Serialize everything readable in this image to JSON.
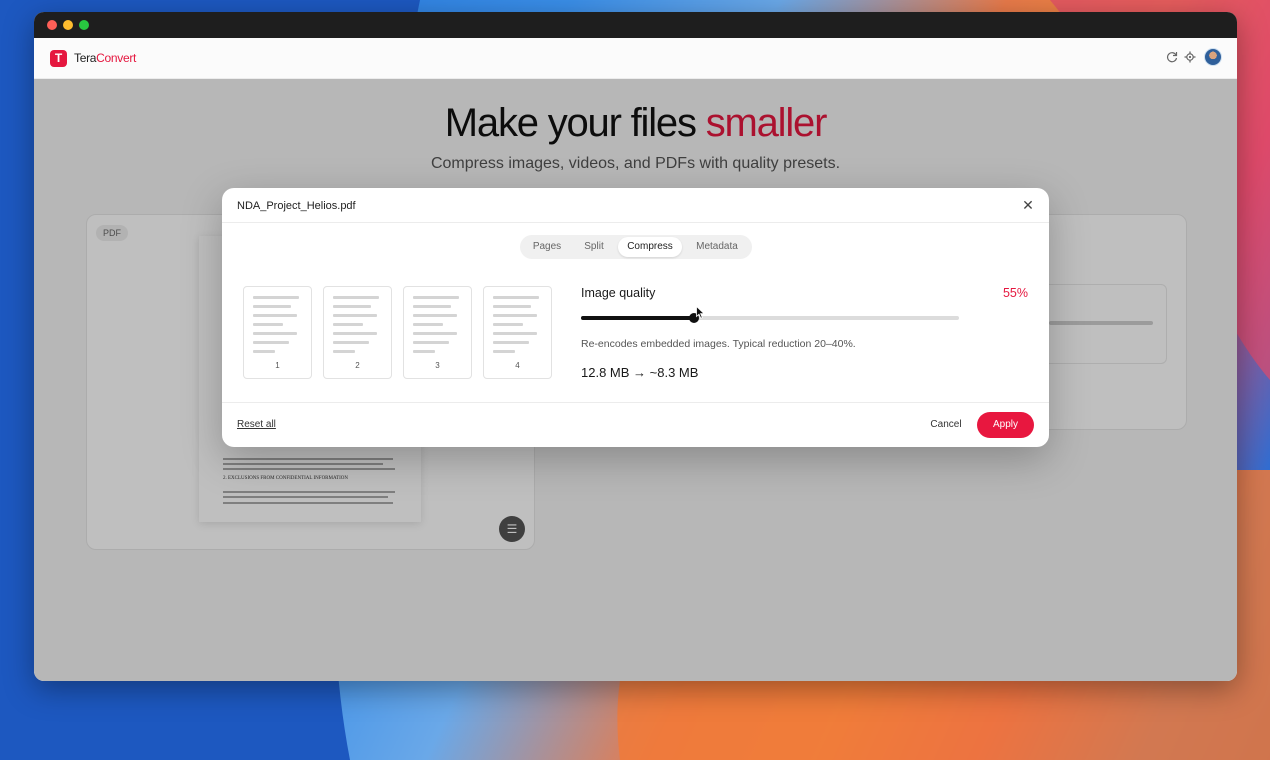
{
  "app": {
    "brand_part1": "Tera",
    "brand_part2": "Convert",
    "logo_letter": "T"
  },
  "header": {
    "icons": [
      "refresh-icon",
      "gear-icon"
    ]
  },
  "hero": {
    "title_main": "Make your files ",
    "title_accent": "smaller",
    "subtitle": "Compress images, videos, and PDFs with quality presets."
  },
  "background_card": {
    "tag": "PDF",
    "doc_heading": "2. EXCLUSIONS FROM CONFIDENTIAL INFORMATION"
  },
  "modal": {
    "filename": "NDA_Project_Helios.pdf",
    "close_symbol": "✕",
    "tabs": [
      {
        "label": "Pages",
        "active": false
      },
      {
        "label": "Split",
        "active": false
      },
      {
        "label": "Compress",
        "active": true
      },
      {
        "label": "Metadata",
        "active": false
      }
    ],
    "thumbnails": [
      {
        "num": "1"
      },
      {
        "num": "2"
      },
      {
        "num": "3"
      },
      {
        "num": "4"
      }
    ],
    "setting": {
      "label": "Image quality",
      "value_text": "55%",
      "value": 0.3,
      "description": "Re-encodes embedded images. Typical reduction 20–40%.",
      "size_change": "12.8 MB → ~8.3 MB"
    },
    "footer": {
      "reset": "Reset all",
      "cancel": "Cancel",
      "apply": "Apply"
    }
  },
  "colors": {
    "accent": "#e5173f",
    "slider_fill": "#111111"
  }
}
